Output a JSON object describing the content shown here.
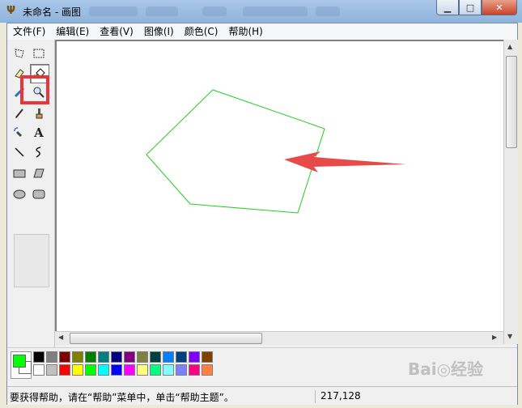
{
  "window": {
    "title": "未命名 - 画图",
    "app_icon": "paint-icon",
    "buttons": {
      "minimize": "▁",
      "maximize": "□",
      "close": "✕"
    }
  },
  "menu": [
    {
      "label": "文件(F)"
    },
    {
      "label": "编辑(E)"
    },
    {
      "label": "查看(V)"
    },
    {
      "label": "图像(I)"
    },
    {
      "label": "颜色(C)"
    },
    {
      "label": "帮助(H)"
    }
  ],
  "tools": [
    {
      "name": "free-select-icon",
      "glyph": "⬠"
    },
    {
      "name": "rect-select-icon",
      "glyph": "⬚"
    },
    {
      "name": "eraser-icon",
      "glyph": "◇"
    },
    {
      "name": "fill-bucket-icon",
      "glyph": "⛾"
    },
    {
      "name": "color-picker-icon",
      "glyph": "✎"
    },
    {
      "name": "magnifier-icon",
      "glyph": "🔍"
    },
    {
      "name": "pencil-icon",
      "glyph": "✏"
    },
    {
      "name": "brush-icon",
      "glyph": "🖌"
    },
    {
      "name": "airbrush-icon",
      "glyph": "✿"
    },
    {
      "name": "text-icon",
      "glyph": "A"
    },
    {
      "name": "line-icon",
      "glyph": "╲"
    },
    {
      "name": "curve-icon",
      "glyph": "∫"
    },
    {
      "name": "rectangle-icon",
      "glyph": "▭"
    },
    {
      "name": "polygon-icon",
      "glyph": "⏢"
    },
    {
      "name": "ellipse-icon",
      "glyph": "⬭"
    },
    {
      "name": "rounded-rect-icon",
      "glyph": "▢"
    }
  ],
  "selected_tool": "fill-bucket-icon",
  "colors": {
    "foreground": "#00ff00",
    "background": "#ffffff",
    "polygon_stroke": "#22cc22",
    "annotation_arrow": "#e84a4a",
    "palette_row1": [
      "#000000",
      "#808080",
      "#800000",
      "#808000",
      "#008000",
      "#008080",
      "#000080",
      "#800080",
      "#808040",
      "#004040",
      "#0080ff",
      "#004080",
      "#8000ff",
      "#804000"
    ],
    "palette_row2": [
      "#ffffff",
      "#c0c0c0",
      "#ff0000",
      "#ffff00",
      "#00ff00",
      "#00ffff",
      "#0000ff",
      "#ff00ff",
      "#ffff80",
      "#00ff80",
      "#80ffff",
      "#8080ff",
      "#ff0080",
      "#ff8040"
    ]
  },
  "status": {
    "help_text": "要获得帮助，请在“帮助”菜单中，单击“帮助主题”。",
    "coordinates": "217,128"
  },
  "watermark": "Bai◎经验"
}
